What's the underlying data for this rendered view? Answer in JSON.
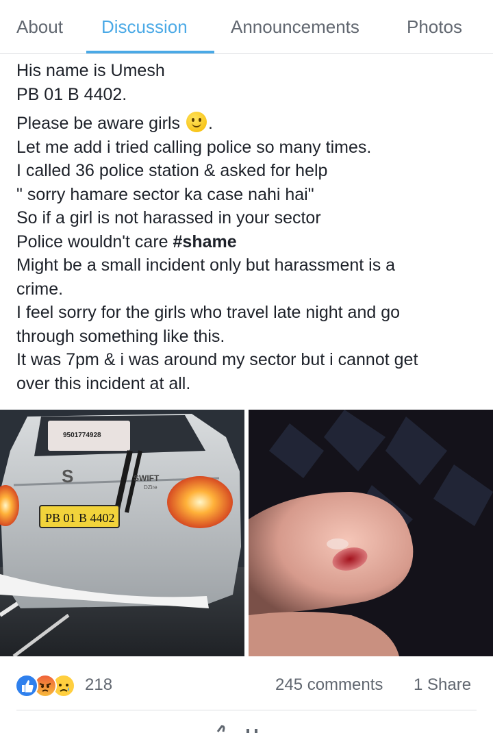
{
  "tabs": [
    {
      "label": "About",
      "active": false
    },
    {
      "label": "Discussion",
      "active": true
    },
    {
      "label": "Announcements",
      "active": false
    },
    {
      "label": "Photos",
      "active": false
    }
  ],
  "post": {
    "lines": [
      "His name is Umesh",
      "PB 01 B 4402.",
      "Please be aware girls",
      ".",
      "Let me add i tried calling police so many times.",
      "I called 36 police station & asked for help",
      "\" sorry hamare sector ka case nahi hai\"",
      "So if a girl is not harassed in your sector",
      "Police wouldn't care ",
      "#shame",
      "Might be a small incident only but harassment is a",
      "crime.",
      "I feel sorry for the girls who travel late night and go",
      "through something like this.",
      "It was 7pm & i was around my sector but i cannot get",
      "over this incident at all."
    ],
    "emoji": "slightly-smiling-face-icon"
  },
  "photos": {
    "car": {
      "plate": "PB 01 B 4402",
      "phone": "9501774928",
      "badge": "SWIFT",
      "badge_sub": "DZire"
    },
    "finger": {}
  },
  "reactions": {
    "icons": [
      "like-icon",
      "angry-icon",
      "sad-icon"
    ],
    "count": "218",
    "comments": "245 comments",
    "shares": "1 Share"
  },
  "colors": {
    "accent": "#4aa9e6",
    "text": "#1d2129",
    "muted": "#616770",
    "like": "#2f80ed"
  }
}
